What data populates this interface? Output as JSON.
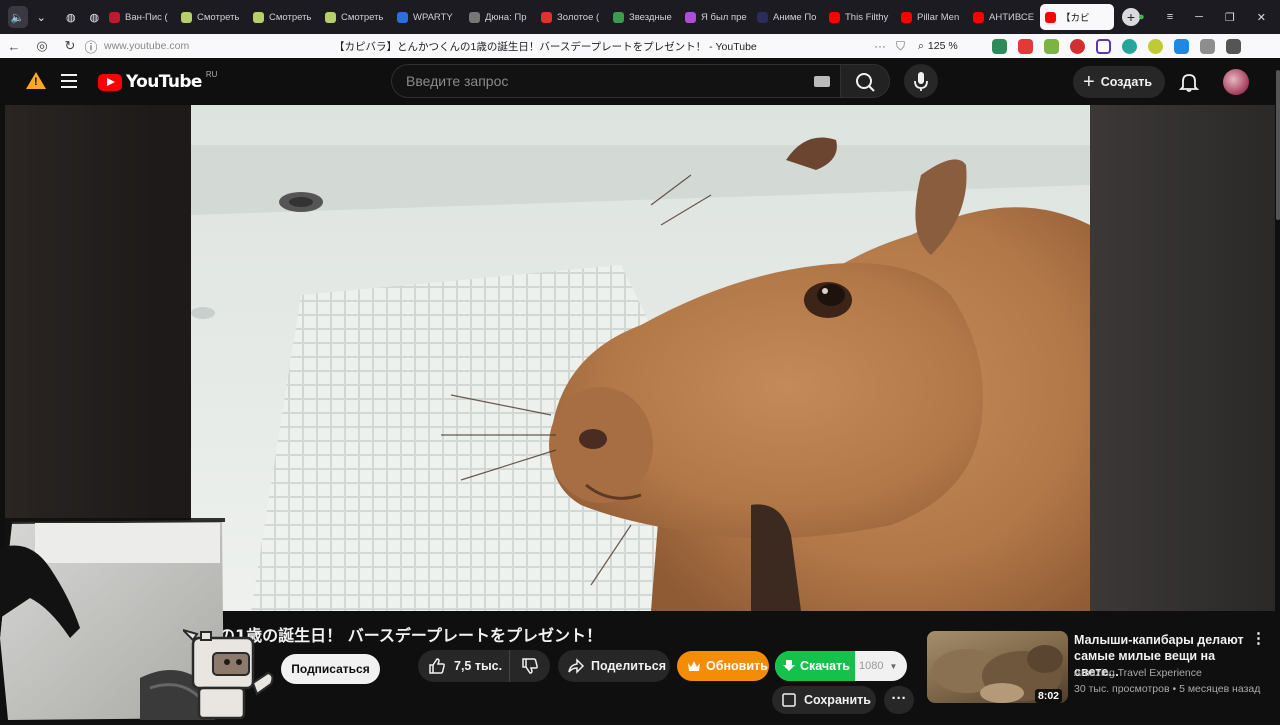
{
  "browser": {
    "tabs": [
      {
        "label": "Ван-Пис (",
        "color": "#c0182c"
      },
      {
        "label": "Смотреть",
        "color": "#b7cf6b"
      },
      {
        "label": "Смотреть",
        "color": "#b7cf6b"
      },
      {
        "label": "Смотреть",
        "color": "#b7cf6b"
      },
      {
        "label": "WPARTY",
        "color": "#2a6fdb"
      },
      {
        "label": "Дюна: Пр",
        "color": "#777777"
      },
      {
        "label": "Золотое (",
        "color": "#e0312c"
      },
      {
        "label": "Звездные",
        "color": "#3b9b4e"
      },
      {
        "label": "Я был пре",
        "color": "#b04dd6"
      },
      {
        "label": "Аниме По",
        "color": "#2b2b5c"
      },
      {
        "label": "This Filthy",
        "color": "#ff0000"
      },
      {
        "label": "Pillar Men",
        "color": "#ff0000"
      },
      {
        "label": "АНТИВСЕ",
        "color": "#ff0000"
      },
      {
        "label": "【カビ",
        "color": "#ff0000"
      }
    ],
    "active_tab_index": 13,
    "new_tab_label": "+",
    "url": "www.youtube.com",
    "page_title": "【カピバラ】とんかつくんの1歳の誕生日！バースデープレートをプレゼント！ - YouTube",
    "zoom": "125 %",
    "window_controls": {
      "minimize": "─",
      "restore": "❐",
      "close": "✕",
      "menu": "≡"
    }
  },
  "youtube": {
    "logo_text": "YouTube",
    "region": "RU",
    "search_placeholder": "Введите запрос",
    "create_label": "Создать"
  },
  "video": {
    "title": "の1歳の誕生日！ バースデープレートをプレゼント！",
    "subscribe_label": "Подписаться",
    "likes": "7,5 тыс.",
    "share_label": "Поделиться",
    "upgrade_label": "Обновить",
    "download_label": "Скачать",
    "download_quality": "1080",
    "save_label": "Сохранить",
    "more_label": "···"
  },
  "recommendation": {
    "title": "Малыши-капибары делают самые милые вещи на свете...",
    "channel": "Amazing Travel Experience",
    "views": "30 тыс. просмотров",
    "separator": "•",
    "age": "5 месяцев назад",
    "duration": "8:02"
  },
  "colors": {
    "yt_red": "#ff0000",
    "upgrade_orange": "#f48c06",
    "download_green": "#14c14b",
    "warning_yellow": "#f9a825"
  }
}
